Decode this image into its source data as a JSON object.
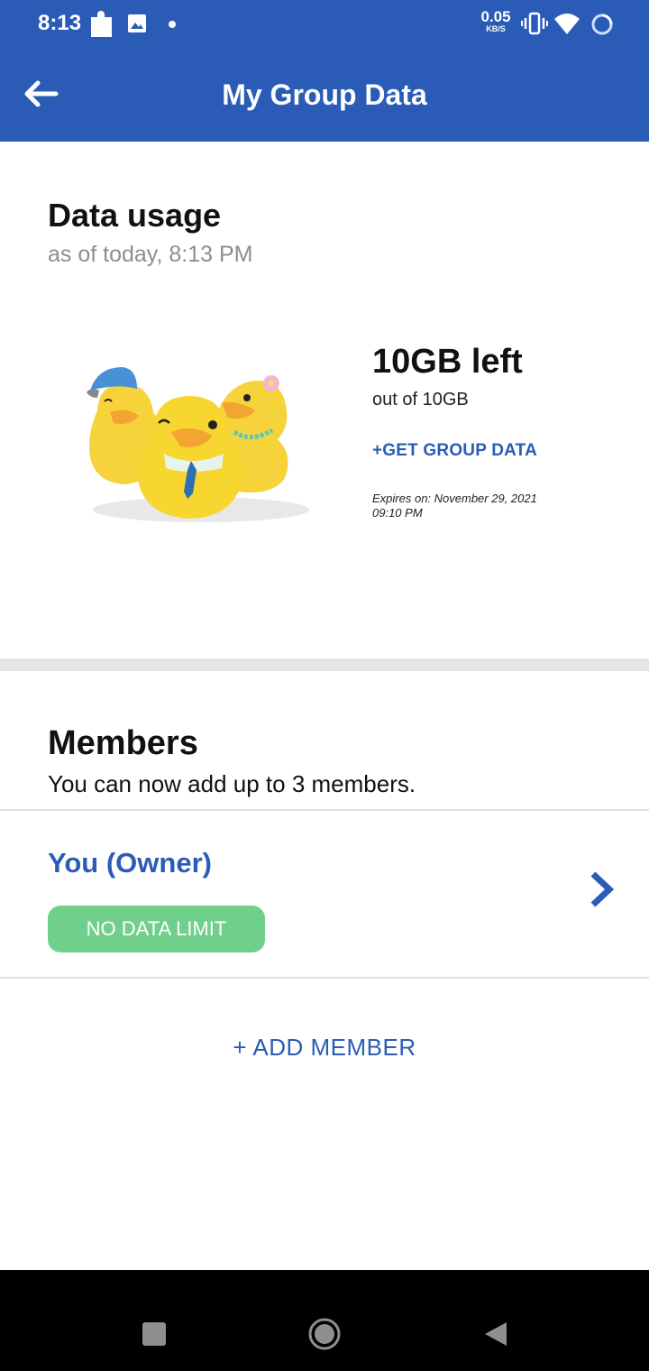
{
  "status_bar": {
    "time": "8:13",
    "net_speed": "0.05",
    "net_speed_unit": "KB/S",
    "icons": [
      "puzzle-icon",
      "image-icon",
      "dot-icon",
      "vibrate-icon",
      "wifi-icon",
      "loading-circle-icon"
    ]
  },
  "app_bar": {
    "title": "My Group Data",
    "back_icon": "arrow-left-icon",
    "color": "#2a5cb7"
  },
  "data_usage": {
    "title": "Data usage",
    "as_of": "as of today, 8:13 PM",
    "illustration": "three-ducks-illustration",
    "remaining": "10GB left",
    "total": "out of 10GB",
    "get_data_link": "+GET GROUP DATA",
    "expires_line1": "Expires on: November 29, 2021",
    "expires_line2": "09:10 PM"
  },
  "members": {
    "title": "Members",
    "subtitle": "You can now add up to 3 members.",
    "list": [
      {
        "name": "You (Owner)",
        "badge": "NO DATA LIMIT",
        "badge_color": "#71cf8c"
      }
    ],
    "add_member_label": "+ ADD MEMBER"
  },
  "nav_bar": {
    "icons": [
      "recents-icon",
      "home-icon",
      "back-icon"
    ]
  }
}
